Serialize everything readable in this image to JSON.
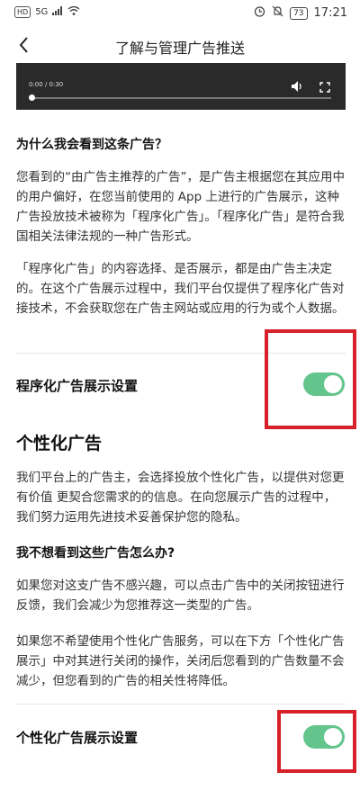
{
  "status_bar": {
    "hd": "HD",
    "signal": "5G",
    "battery": "73",
    "time": "17:21"
  },
  "header": {
    "title": "了解与管理广告推送"
  },
  "video": {
    "time": "0:00 / 0:30"
  },
  "section1": {
    "heading": "为什么我会看到这条广告？",
    "p1": "您看到的“由广告主推荐的广告”，是广告主根据您在其应用中的用户偏好，在您当前使用的 App 上进行的广告展示，这种广告投放技术被称为「程序化广告」。「程序化广告」是符合我国相关法律法规的一种广告形式。",
    "p2": "「程序化广告」的内容选择、是否展示，都是由广告主决定的。在这个广告展示过程中，我们平台仅提供了程序化广告对接技术，不会获取您在广告主网站或应用的行为或个人数据。"
  },
  "setting1": {
    "label": "程序化广告展示设置",
    "enabled": true
  },
  "section2": {
    "title": "个性化广告",
    "p1": "我们平台上的广告主，会选择投放个性化广告，以提供对您更有价值 更契合您需求的的信息。在向您展示广告的过程中，我们努力运用先进技术妥善保护您的隐私。",
    "heading": "我不想看到这些广告怎么办?",
    "p2": "如果您对这支广告不感兴趣，可以点击广告中的关闭按钮进行反馈，我们会减少为您推荐这一类型的广告。",
    "p3": "如果您不希望使用个性化广告服务，可以在下方「个性化广告展示」中对其进行关闭的操作，关闭后您看到的广告数量不会减少，但您看到的广告的相关性将降低。"
  },
  "setting2": {
    "label": "个性化广告展示设置",
    "enabled": true
  },
  "colors": {
    "toggle_on": "#63c48c",
    "highlight": "#d6202a"
  }
}
